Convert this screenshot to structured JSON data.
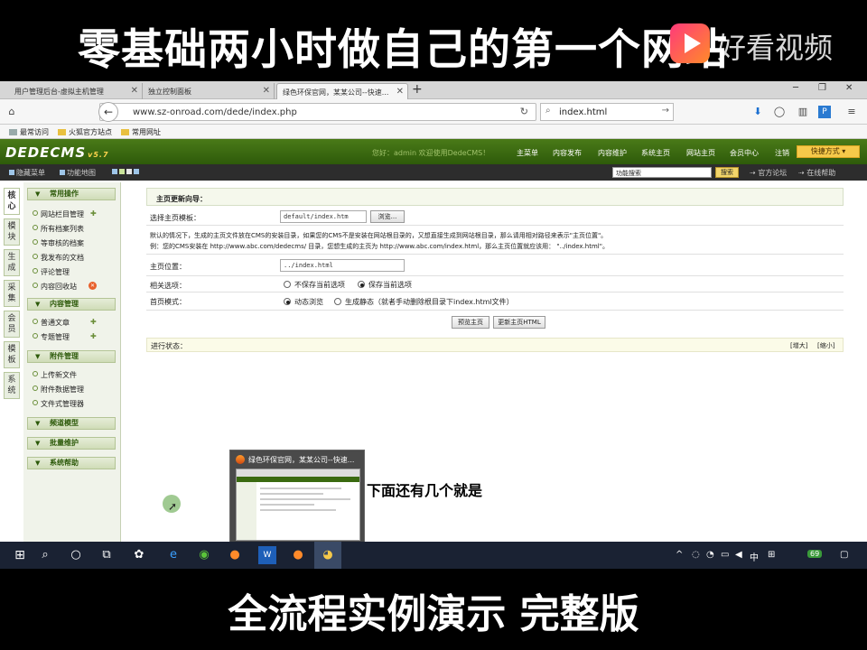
{
  "overlay": {
    "top_caption": "零基础两小时做自己的第一个网站",
    "watermark": "好看视频",
    "bottom_caption": "全流程实例演示 完整版",
    "hint_text": "下面还有几个就是"
  },
  "browser": {
    "tabs": [
      {
        "label": "用户管理后台-虚拟主机管理"
      },
      {
        "label": "独立控制面板"
      },
      {
        "label": "绿色环保官网，某某公司--快速..."
      }
    ],
    "url": "www.sz-onroad.com/dede/index.php",
    "search_value": "index.html",
    "bookmarks": [
      "最常访问",
      "火狐官方站点",
      "常用网址"
    ]
  },
  "dede": {
    "logo": "DEDECMS",
    "version": "v5.7",
    "greeting": "您好：admin  欢迎使用DedeCMS！",
    "topnav": [
      "主菜单",
      "内容发布",
      "内容维护",
      "系统主页",
      "网站主页",
      "会员中心",
      "注销"
    ],
    "quick": "快捷方式 ▾",
    "subbar": {
      "hide_menu": "隐藏菜单",
      "sitemap": "功能地图"
    },
    "func_search_value": "功能搜索",
    "search_btn": "搜索",
    "forum": "官方论坛",
    "help": "在线帮助",
    "vtabs": [
      "核心",
      "模块",
      "生成",
      "采集",
      "会员",
      "模板",
      "系统"
    ],
    "sections": {
      "common": "常用操作",
      "content": "内容管理",
      "attach": "附件管理",
      "channel": "频道模型",
      "batch": "批量维护",
      "sysbank": "系统帮助"
    },
    "common_items": [
      "网站栏目管理",
      "所有档案列表",
      "等审核的档案",
      "我发布的文档",
      "评论管理",
      "内容回收站"
    ],
    "content_items": [
      "普通文章",
      "专题管理"
    ],
    "attach_items": [
      "上传新文件",
      "附件数据管理",
      "文件式管理器"
    ]
  },
  "form": {
    "title": "主页更新向导：",
    "template_label": "选择主页模板：",
    "template_value": "default/index.htm",
    "browse_btn": "浏览...",
    "note1": "默认的情况下，生成的主页文件放在CMS的安装目录，如果您的CMS不是安装在网站根目录的，又想直接生成到网站根目录，那么请用相对路径来表示\"主页位置\"。",
    "note2": "例：您的CMS安装在  http://www.abc.com/dedecms/ 目录，您想生成的主页为 http://www.abc.com/index.html，那么主页位置就应该用： \"../index.html\"。",
    "location_label": "主页位置：",
    "location_value": "../index.html",
    "related_label": "相关选项：",
    "opt_no_save": "不保存当前选项",
    "opt_save": "保存当前选项",
    "mode_label": "首页模式：",
    "mode_dynamic": "动态浏览",
    "mode_static": "生成静态（就者手动删除根目录下index.html文件）",
    "preview_btn": "预览主页",
    "update_btn": "更新主页HTML",
    "progress_label": "进行状态：",
    "enlarge": "[增大]",
    "shrink": "[缩小]"
  },
  "popup": {
    "title": "绿色环保官网，某某公司--快速..."
  },
  "taskbar": {
    "lang": "中",
    "badge": "69"
  }
}
